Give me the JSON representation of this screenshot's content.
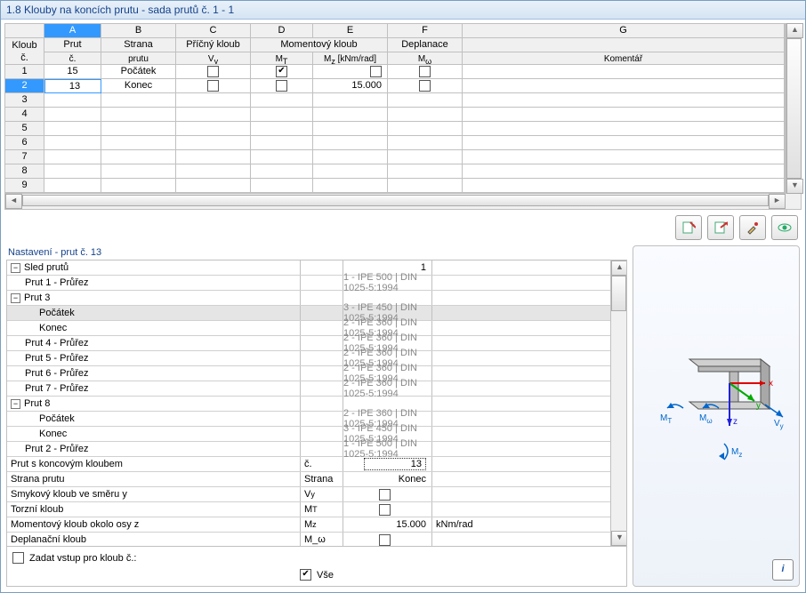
{
  "title": "1.8 Klouby na koncích prutu - sada prutů č. 1 - 1",
  "topHeaders": {
    "rowNo": "Kloub\nč.",
    "letters": [
      "A",
      "B",
      "C",
      "D",
      "E",
      "F",
      "G"
    ],
    "line1": [
      "Prut",
      "Strana",
      "Příčný kloub",
      "Momentový kloub",
      "",
      "Deplanace",
      ""
    ],
    "line2": [
      "č.",
      "prutu",
      "V_y",
      "M_T",
      "M_z [kNm/rad]",
      "M_ω",
      "Komentář"
    ]
  },
  "rows": [
    {
      "n": "1",
      "prut": "15",
      "strana": "Počátek",
      "vy": false,
      "mt": true,
      "mz": "",
      "mw": false
    },
    {
      "n": "2",
      "prut": "13",
      "strana": "Konec",
      "vy": false,
      "mt": false,
      "mz": "15.000",
      "mw": false
    }
  ],
  "emptyRows": [
    "3",
    "4",
    "5",
    "6",
    "7",
    "8",
    "9"
  ],
  "sectTitle": "Nastavení - prut č. 13",
  "props": [
    {
      "t": 0,
      "lbl": "Sled prutů",
      "val": "1"
    },
    {
      "t": 1,
      "lbl": "Prut 1 - Průřez",
      "val": "1 - IPE 500 | DIN 1025-5:1994",
      "g": true
    },
    {
      "t": 0,
      "lbl": "Prut 3"
    },
    {
      "t": 2,
      "lbl": "Počátek",
      "val": "3 - IPE 450 | DIN 1025-5:1994",
      "g": true,
      "sel": true
    },
    {
      "t": 2,
      "lbl": "Konec",
      "val": "2 - IPE 360 | DIN 1025-5:1994",
      "g": true
    },
    {
      "t": 1,
      "lbl": "Prut 4 - Průřez",
      "val": "2 - IPE 360 | DIN 1025-5:1994",
      "g": true
    },
    {
      "t": 1,
      "lbl": "Prut 5 - Průřez",
      "val": "2 - IPE 360 | DIN 1025-5:1994",
      "g": true
    },
    {
      "t": 1,
      "lbl": "Prut 6 - Průřez",
      "val": "2 - IPE 360 | DIN 1025-5:1994",
      "g": true
    },
    {
      "t": 1,
      "lbl": "Prut 7 - Průřez",
      "val": "2 - IPE 360 | DIN 1025-5:1994",
      "g": true
    },
    {
      "t": 0,
      "lbl": "Prut 8"
    },
    {
      "t": 2,
      "lbl": "Počátek",
      "val": "2 - IPE 360 | DIN 1025-5:1994",
      "g": true
    },
    {
      "t": 2,
      "lbl": "Konec",
      "val": "3 - IPE 450 | DIN 1025-5:1994",
      "g": true
    },
    {
      "t": 1,
      "lbl": "Prut 2 - Průřez",
      "val": "1 - IPE 500 | DIN 1025-5:1994",
      "g": true
    },
    {
      "t": -1,
      "lbl": "Prut s koncovým kloubem",
      "m": "č.",
      "val": "13",
      "dotted": true
    },
    {
      "t": -1,
      "lbl": "Strana prutu",
      "m": "Strana",
      "val": "Konec"
    },
    {
      "t": -1,
      "lbl": "Smykový kloub ve směru y",
      "m": "V_y",
      "cb": false
    },
    {
      "t": -1,
      "lbl": "Torzní kloub",
      "m": "M_T",
      "cb": false
    },
    {
      "t": -1,
      "lbl": "Momentový kloub okolo osy z",
      "m": "M_z",
      "val": "15.000",
      "unit": "kNm/rad"
    },
    {
      "t": -1,
      "lbl": "Deplanační kloub",
      "m": "M_ω",
      "cb": false
    }
  ],
  "footer": {
    "zadat": "Zadat vstup pro kloub č.:",
    "vse": "Vše"
  },
  "axes": {
    "x": "x",
    "y": "y",
    "z": "z",
    "mt": "M_T",
    "mw": "M_ω",
    "mz": "M_z",
    "vy": "V_y"
  }
}
